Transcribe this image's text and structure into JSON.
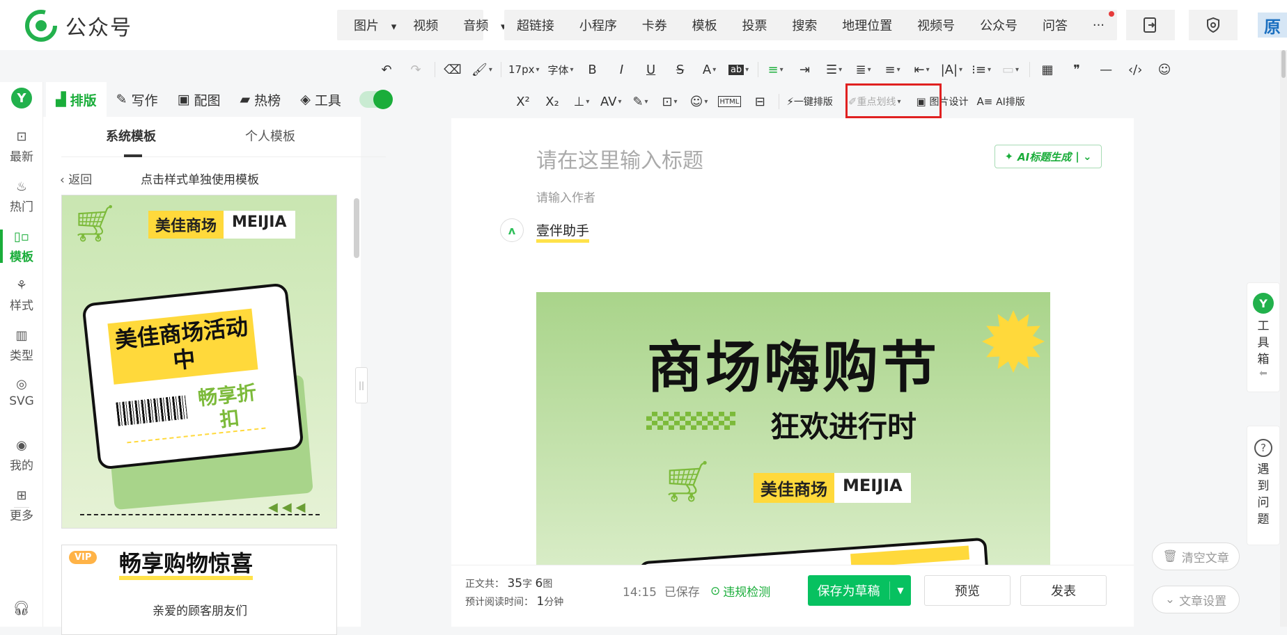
{
  "app": {
    "name": "公众号"
  },
  "top_nav": {
    "media": [
      "图片",
      "视频",
      "音频"
    ],
    "inserts": [
      "超链接",
      "小程序",
      "卡券",
      "模板",
      "投票",
      "搜索",
      "地理位置",
      "视频号",
      "公众号",
      "问答",
      "···"
    ],
    "avatar_text": "原"
  },
  "toolbar": {
    "font_size": "17px",
    "font_family": "字体",
    "row1_glyphs": [
      "B",
      "I",
      "U",
      "S",
      "A",
      "ab"
    ],
    "superscript": "X²",
    "subscript": "X₂",
    "html_label": "HTML",
    "one_click": "一键排版",
    "highlight_underline": "重点划线",
    "image_design": "图片设计",
    "ai_layout": "AI排版"
  },
  "left_nav": {
    "items": [
      {
        "label": "最新",
        "icon": "latest-icon"
      },
      {
        "label": "热门",
        "icon": "fire-icon"
      },
      {
        "label": "模板",
        "icon": "template-icon"
      },
      {
        "label": "样式",
        "icon": "style-icon"
      },
      {
        "label": "类型",
        "icon": "type-icon"
      },
      {
        "label": "SVG",
        "icon": "svg-icon"
      },
      {
        "label": "我的",
        "icon": "user-icon"
      },
      {
        "label": "更多",
        "icon": "more-icon"
      }
    ],
    "active": "模板",
    "accent": "#1aad3a"
  },
  "tabs": [
    {
      "label": "排版",
      "icon": "layout-icon"
    },
    {
      "label": "写作",
      "icon": "write-icon"
    },
    {
      "label": "配图",
      "icon": "image-icon"
    },
    {
      "label": "热榜",
      "icon": "bookmark-icon"
    },
    {
      "label": "工具",
      "icon": "cube-icon"
    }
  ],
  "template_panel": {
    "tabs": [
      "系统模板",
      "个人模板"
    ],
    "back": "返回",
    "hint": "点击样式单独使用模板",
    "card1": {
      "brand_cn": "美佳商场",
      "brand_en": "MEIJIA",
      "title": "美佳商场活动中",
      "sub": "畅享折扣"
    },
    "card2": {
      "vip": "VIP",
      "title": "畅享购物惊喜",
      "sub": "亲爱的顾客朋友们"
    }
  },
  "editor": {
    "title_placeholder": "请在这里输入标题",
    "ai_title": "AI标题生成",
    "author_placeholder": "请输入作者",
    "brand_name": "壹伴助手",
    "banner": {
      "title": "商场嗨购节",
      "sub": "狂欢进行时",
      "brand_cn": "美佳商场",
      "brand_en": "MEIJIA"
    }
  },
  "bottom_bar": {
    "word_count_label": "正文共：",
    "word_count": "35",
    "word_unit": "字",
    "image_count": "6",
    "image_unit": "图",
    "read_time_label": "预计阅读时间：",
    "read_time": "1",
    "read_unit": "分钟",
    "saved_time": "14:15",
    "saved_text": "已保存",
    "check": "违规检测",
    "save_draft": "保存为草稿",
    "preview": "预览",
    "publish": "发表"
  },
  "right_side": {
    "toolbox": "工具箱",
    "help": "遇到问题",
    "clear": "清空文章",
    "settings": "文章设置"
  }
}
